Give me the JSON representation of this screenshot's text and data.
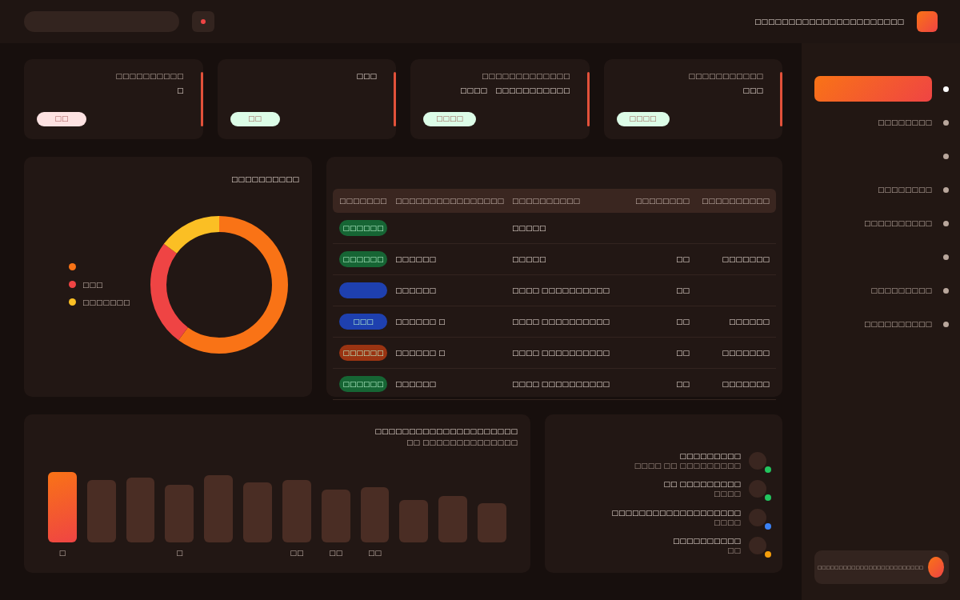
{
  "topbar": {
    "user_text": "□□□□□□□□□□□□□□□□□□□□□□"
  },
  "kpis": [
    {
      "label": "□□□□□□□□□□",
      "value": "□",
      "badge": "□□",
      "color": "#fde2e2"
    },
    {
      "value": "□□□",
      "badge": "□□",
      "color": "#dcfce7"
    },
    {
      "label": "□□□□□□□□□□□□□",
      "value": "□□□□□□□□□□□",
      "note": "□□□□",
      "badge": "□□□□",
      "color": "#dcfce7"
    },
    {
      "label": "□□□□□□□□□□□",
      "value": "□□□",
      "badge": "□□□□",
      "color": "#dcfce7"
    }
  ],
  "donut_card": {
    "title": "□□□□□□□□□□",
    "legend": [
      {
        "color": "#f97316"
      },
      {
        "label": "□□□",
        "color": "#ef4444"
      },
      {
        "label": "□□□□□□□",
        "color": "#fbbf24"
      }
    ]
  },
  "table": {
    "columns": [
      "□□□□□□□",
      "□□□□□□□□□□□□□□□□",
      "□□□□□□□□□□",
      "□□□□□□□□",
      "□□□□□□□□□□"
    ],
    "rows": [
      {
        "cells": [
          {
            "label": "□□□□□□",
            "color": "#166534"
          },
          "",
          "□□□□□",
          "",
          ""
        ]
      },
      {
        "cells": [
          {
            "label": "□□□□□□",
            "color": "#166534"
          },
          "□□□□□□",
          "□□□□□",
          "□□",
          "□□□□□□□"
        ]
      },
      {
        "cells": [
          {
            "color": "#1e40af"
          },
          "□□□□□□",
          "□□□□ □□□□□□□□□□",
          "□□",
          ""
        ]
      },
      {
        "cells": [
          {
            "label": "□□□",
            "color": "#1e40af"
          },
          "□□□□□□ □",
          "□□□□ □□□□□□□□□□",
          "□□",
          "□□□□□□"
        ]
      },
      {
        "cells": [
          {
            "label": "□□□□□□",
            "color": "#9a3412"
          },
          "□□□□□□ □",
          "□□□□ □□□□□□□□□□",
          "□□",
          "□□□□□□□"
        ]
      },
      {
        "cells": [
          {
            "label": "□□□□□□",
            "color": "#166534"
          },
          "□□□□□□",
          "□□□□ □□□□□□□□□□",
          "□□",
          "□□□□□□□"
        ]
      }
    ]
  },
  "bar_card": {
    "title": "□□□□□□□□□□□□□□□□□□□□□",
    "subtitle": "□□ □□□□□□□□□□□□□□",
    "bars": [
      {
        "label": "□",
        "selected": true
      },
      {
        "selected": false
      },
      {
        "selected": false
      },
      {
        "label": "□",
        "selected": false
      },
      {
        "selected": false
      },
      {
        "selected": false
      },
      {
        "label": "□□",
        "selected": false
      },
      {
        "label": "□□",
        "selected": false
      },
      {
        "label": "□□",
        "selected": false
      },
      {
        "selected": false
      },
      {
        "selected": false
      },
      {
        "selected": false
      }
    ]
  },
  "activity": [
    {
      "title": "□□□□□□□□□",
      "subtitle": "□□□□ □□ □□□□□□□□□",
      "color": "#22c55e"
    },
    {
      "title": "□□ □□□□□□□□□",
      "subtitle": "□□□□",
      "color": "#22c55e"
    },
    {
      "title": "□□□□□□□□□□□□□□□□□□□",
      "subtitle": "□□□□",
      "color": "#3b82f6"
    },
    {
      "title": "□□□□□□□□□□",
      "subtitle": "□□",
      "color": "#f59e0b"
    }
  ],
  "sidebar": {
    "items": [
      {
        "selected": true
      },
      {
        "label": "□□□□□□□□",
        "selected": false
      },
      {
        "selected": false
      },
      {
        "label": "□□□□□□□□",
        "selected": false
      },
      {
        "label": "□□□□□□□□□□",
        "selected": false
      },
      {
        "selected": false
      },
      {
        "label": "□□□□□□□□□",
        "selected": false
      },
      {
        "label": "□□□□□□□□□□",
        "selected": false
      }
    ],
    "user_text": "□□□□□□□□□□□□□□□□□□□□□□□□□"
  }
}
